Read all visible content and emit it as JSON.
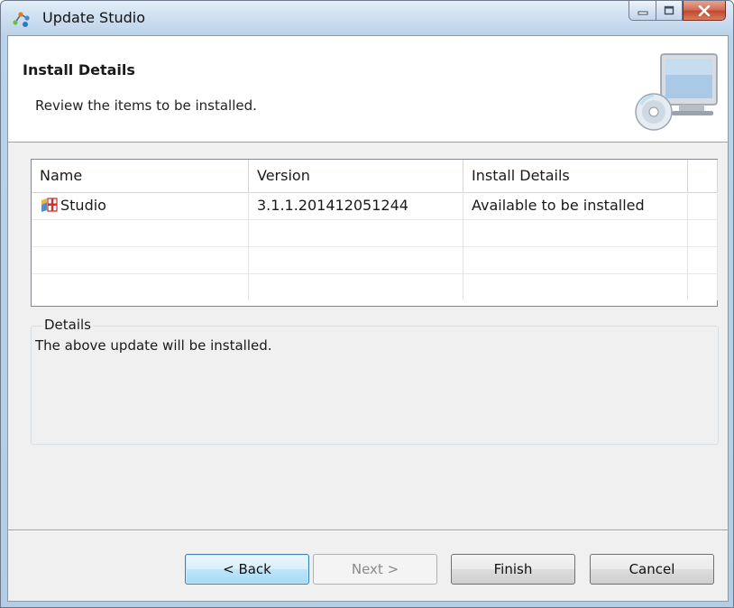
{
  "window": {
    "title": "Update Studio",
    "icon": "update-studio-app-icon",
    "controls": {
      "minimize_icon": "minimize-icon",
      "maximize_icon": "maximize-icon",
      "close_icon": "close-icon"
    }
  },
  "header": {
    "title": "Install Details",
    "description": "Review the items to be installed.",
    "banner_icon": "computer-cd-icon"
  },
  "table": {
    "columns": [
      "Name",
      "Version",
      "Install Details"
    ],
    "rows": [
      {
        "name": "Studio",
        "icon": "feature-package-icon",
        "version": "3.1.1.201412051244",
        "details": "Available to be installed"
      }
    ]
  },
  "details": {
    "label": "Details",
    "text": "The above update will be installed."
  },
  "buttons": {
    "back": "< Back",
    "next": "Next >",
    "finish": "Finish",
    "cancel": "Cancel"
  },
  "colors": {
    "title_bar": "#c9ddf0",
    "dialog_background": "#f0f0f0",
    "default_button_border": "#3c7fb1",
    "close_button": "#c94d33"
  }
}
